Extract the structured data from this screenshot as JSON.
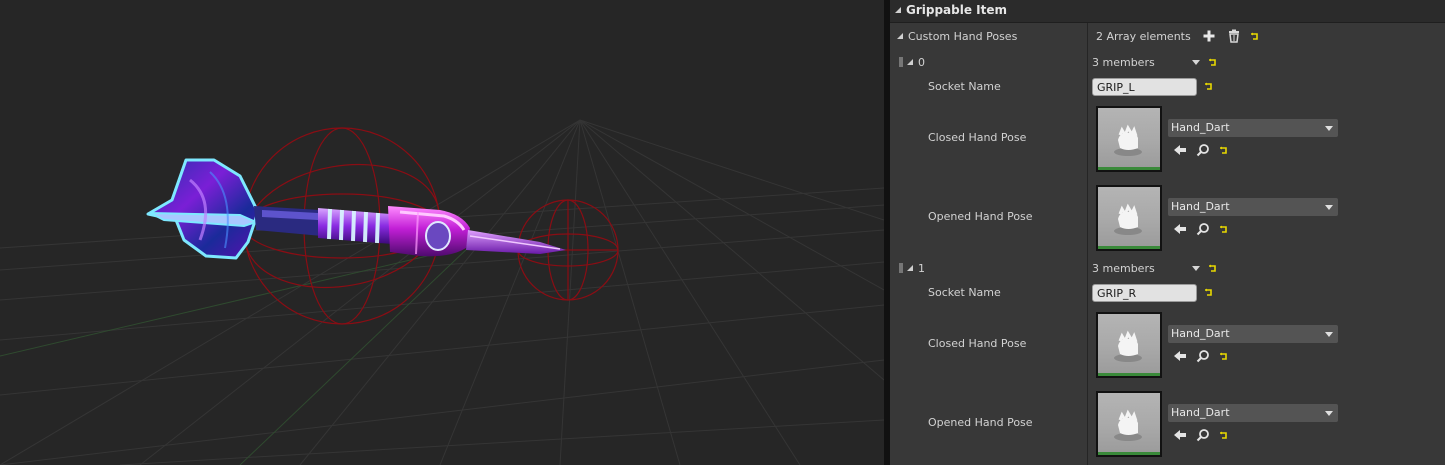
{
  "colors": {
    "panel_bg": "#383838",
    "viewport_bg": "#262626",
    "header_bg": "#2b2b2b",
    "reset_yellow": "#e8d800",
    "wire_red": "#8a0d14",
    "dart_purple": "#7a1fd6",
    "dart_cyan": "#7ee8ff",
    "thumb_bar_green": "#3a8a3a"
  },
  "viewport": {
    "name": "3D viewport showing dart mesh with red collision spheres on a perspective grid"
  },
  "details": {
    "category_title": "Grippable Item",
    "property_label": "Custom Hand Poses",
    "array_count": "2 Array elements",
    "add_icon": "plus-icon",
    "delete_icon": "trash-icon",
    "reset_icon": "reset-arrow-icon",
    "elements": [
      {
        "index": "0",
        "members": "3 members",
        "socket_label": "Socket Name",
        "socket_value": "GRIP_L",
        "closed_label": "Closed Hand Pose",
        "closed_asset": "Hand_Dart",
        "opened_label": "Opened Hand Pose",
        "opened_asset": "Hand_Dart"
      },
      {
        "index": "1",
        "members": "3 members",
        "socket_label": "Socket Name",
        "socket_value": "GRIP_R",
        "closed_label": "Closed Hand Pose",
        "closed_asset": "Hand_Dart",
        "opened_label": "Opened Hand Pose",
        "opened_asset": "Hand_Dart"
      }
    ],
    "asset_icons": [
      "use-selected-arrow-icon",
      "browse-magnifier-icon"
    ]
  }
}
